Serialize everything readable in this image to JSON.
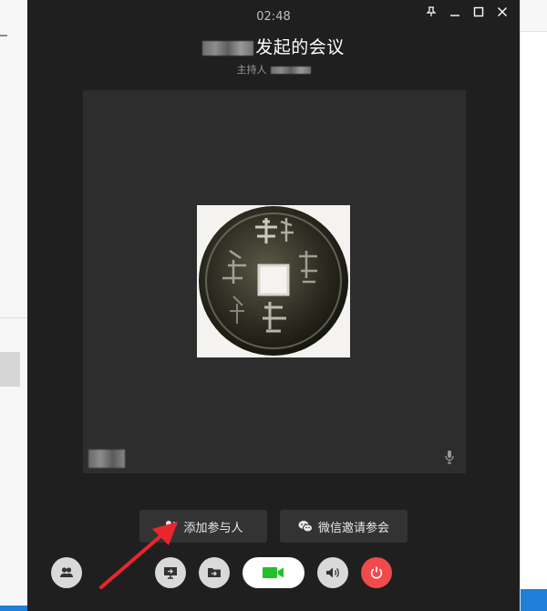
{
  "meeting": {
    "timer": "02:48",
    "title": "发起的会议",
    "host_label": "主持人"
  },
  "actions": {
    "add_participant": "添加参与人",
    "wechat_invite": "微信邀请参会"
  },
  "icons": {
    "pin": "pin-icon",
    "minimize": "minimize-icon",
    "maximize": "maximize-icon",
    "close": "close-icon",
    "add_user": "add-user-icon",
    "wechat": "wechat-icon",
    "members": "members-icon",
    "screen_share": "screen-share-icon",
    "file_share": "file-share-icon",
    "camera": "camera-icon",
    "speaker": "speaker-icon",
    "power": "power-icon",
    "mic": "mic-icon"
  },
  "colors": {
    "camera_active": "#22c02a",
    "end_call": "#f04a4a",
    "annotation_arrow": "#e8262c"
  }
}
